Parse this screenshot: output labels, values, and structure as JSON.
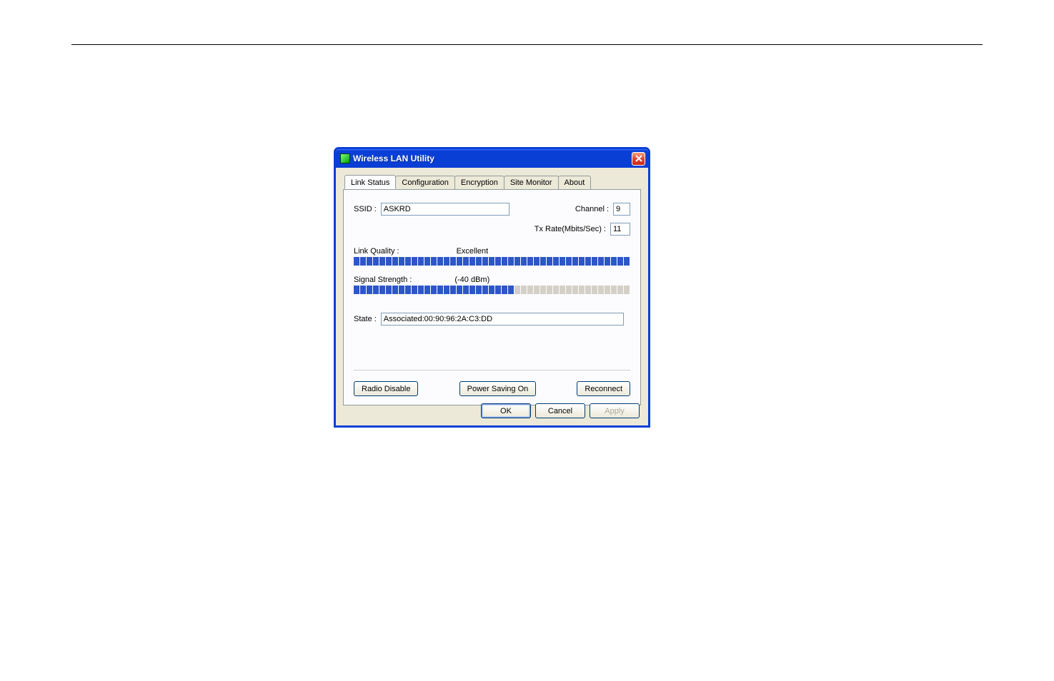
{
  "window": {
    "title": "Wireless LAN Utility"
  },
  "tabs": {
    "link_status": "Link Status",
    "configuration": "Configuration",
    "encryption": "Encryption",
    "site_monitor": "Site Monitor",
    "about": "About"
  },
  "link_status": {
    "ssid_label": "SSID :",
    "ssid_value": "ASKRD",
    "channel_label": "Channel :",
    "channel_value": "9",
    "txrate_label": "Tx Rate(Mbits/Sec) :",
    "txrate_value": "11",
    "link_quality_label": "Link Quality :",
    "link_quality_value": "Excellent",
    "signal_strength_label": "Signal Strength :",
    "signal_strength_value": "(-40 dBm)",
    "state_label": "State :",
    "state_value": "Associated:00:90:96:2A:C3:DD",
    "link_quality_percent": 100,
    "signal_strength_percent": 58
  },
  "buttons": {
    "radio_disable": "Radio Disable",
    "power_saving": "Power Saving On",
    "reconnect": "Reconnect",
    "ok": "OK",
    "cancel": "Cancel",
    "apply": "Apply"
  }
}
